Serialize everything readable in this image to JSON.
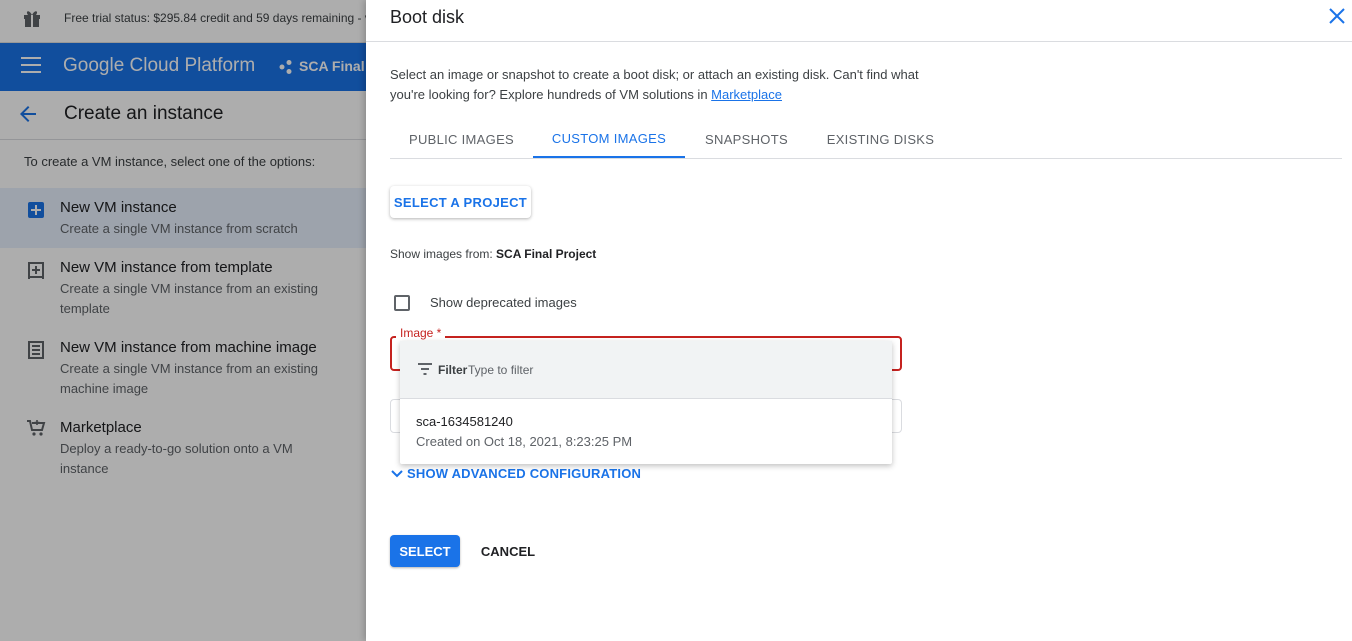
{
  "background": {
    "trial_status": "Free trial status: $295.84 credit and 59 days remaining - v",
    "brand": "Google Cloud Platform",
    "project_short": "SCA Final P",
    "page_title": "Create an instance",
    "intro": "To create a VM instance, select one of the options:",
    "options": [
      {
        "title": "New VM instance",
        "desc": "Create a single VM instance from scratch",
        "icon": "add-box-icon",
        "selected": true
      },
      {
        "title": "New VM instance from template",
        "desc": "Create a single VM instance from an existing template",
        "icon": "template-icon",
        "selected": false
      },
      {
        "title": "New VM instance from machine image",
        "desc": "Create a single VM instance from an existing machine image",
        "icon": "machine-image-icon",
        "selected": false
      },
      {
        "title": "Marketplace",
        "desc": "Deploy a ready-to-go solution onto a VM instance",
        "icon": "cart-icon",
        "selected": false
      }
    ]
  },
  "panel": {
    "title": "Boot disk",
    "description": "Select an image or snapshot to create a boot disk; or attach an existing disk. Can't find what you're looking for? Explore hundreds of VM solutions in ",
    "marketplace_link": "Marketplace",
    "tabs": [
      "PUBLIC IMAGES",
      "CUSTOM IMAGES",
      "SNAPSHOTS",
      "EXISTING DISKS"
    ],
    "active_tab": "CUSTOM IMAGES",
    "select_project_label": "SELECT A PROJECT",
    "show_images_from_label": "Show images from: ",
    "show_images_from_value": "SCA Final Project",
    "deprecated_label": "Show deprecated images",
    "deprecated_checked": false,
    "image_label": "Image *",
    "advanced_label": "SHOW ADVANCED CONFIGURATION",
    "select_button": "SELECT",
    "cancel_button": "CANCEL"
  },
  "dropdown": {
    "filter_label": "Filter",
    "filter_placeholder": "Type to filter",
    "items": [
      {
        "name": "sca-1634581240",
        "created": "Created on Oct 18, 2021, 8:23:25 PM"
      }
    ]
  },
  "colors": {
    "accent": "#1a73e8",
    "error": "#c5221f",
    "nav_bar": "#1a73e8"
  }
}
